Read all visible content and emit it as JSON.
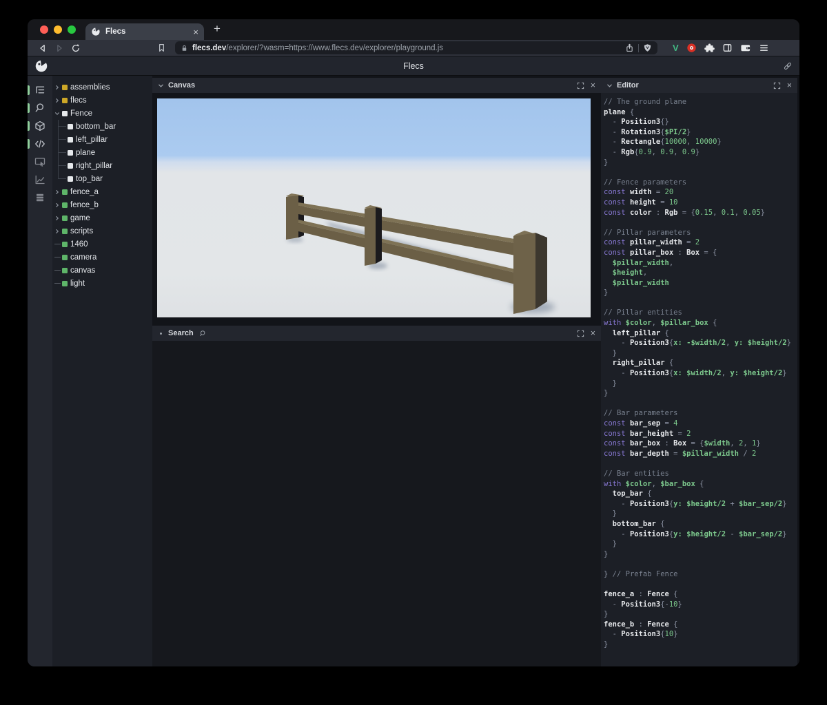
{
  "browser": {
    "traffic_lights": {
      "close": "#ff5f57",
      "minimize": "#febc2e",
      "zoom": "#28c840"
    },
    "tab": {
      "title": "Flecs",
      "close_glyph": "×",
      "new_tab_glyph": "+"
    },
    "url": {
      "domain": "flecs.dev",
      "path": "/explorer/?wasm=https://www.flecs.dev/explorer/playground.js"
    },
    "extensions": {
      "vue_label": "V"
    }
  },
  "app": {
    "header_title": "Flecs",
    "panels": {
      "canvas": "Canvas",
      "search": "Search",
      "editor": "Editor"
    }
  },
  "sidebar_icons": [
    {
      "name": "entity-tree",
      "active": true
    },
    {
      "name": "search",
      "active": true
    },
    {
      "name": "cube-3d",
      "active": true
    },
    {
      "name": "code",
      "active": true
    },
    {
      "name": "screen-inspect",
      "active": false
    },
    {
      "name": "stats-chart",
      "active": false
    },
    {
      "name": "layers",
      "active": false
    }
  ],
  "tree": {
    "items": [
      {
        "label": "assemblies",
        "kind": "module",
        "marker": "collapsed"
      },
      {
        "label": "flecs",
        "kind": "module",
        "marker": "collapsed"
      },
      {
        "label": "Fence",
        "kind": "prefab",
        "marker": "expanded"
      },
      {
        "label": "bottom_bar",
        "kind": "prefab",
        "marker": "child"
      },
      {
        "label": "left_pillar",
        "kind": "prefab",
        "marker": "child"
      },
      {
        "label": "plane",
        "kind": "prefab",
        "marker": "child"
      },
      {
        "label": "right_pillar",
        "kind": "prefab",
        "marker": "child"
      },
      {
        "label": "top_bar",
        "kind": "prefab",
        "marker": "child"
      },
      {
        "label": "fence_a",
        "kind": "entity",
        "marker": "collapsed"
      },
      {
        "label": "fence_b",
        "kind": "entity",
        "marker": "collapsed"
      },
      {
        "label": "game",
        "kind": "entity",
        "marker": "collapsed"
      },
      {
        "label": "scripts",
        "kind": "entity",
        "marker": "collapsed"
      },
      {
        "label": "1460",
        "kind": "entity",
        "marker": "leaf"
      },
      {
        "label": "camera",
        "kind": "entity",
        "marker": "leaf"
      },
      {
        "label": "canvas",
        "kind": "entity",
        "marker": "leaf"
      },
      {
        "label": "light",
        "kind": "entity",
        "marker": "leaf"
      }
    ],
    "dot_colors": {
      "module": "#cda727",
      "prefab": "#e6e9ec",
      "entity": "#5eb569"
    }
  },
  "editor_code": {
    "lines": [
      [
        [
          "// The ground plane",
          "c"
        ]
      ],
      [
        [
          "plane",
          "i"
        ],
        [
          " {",
          "p"
        ]
      ],
      [
        [
          "  - ",
          "p"
        ],
        [
          "Position3",
          "i"
        ],
        [
          "{}",
          "p"
        ]
      ],
      [
        [
          "  - ",
          "p"
        ],
        [
          "Rotation3",
          "i"
        ],
        [
          "{",
          "p"
        ],
        [
          "$PI/2",
          "v"
        ],
        [
          "}",
          "p"
        ]
      ],
      [
        [
          "  - ",
          "p"
        ],
        [
          "Rectangle",
          "i"
        ],
        [
          "{",
          "p"
        ],
        [
          "10000",
          "n"
        ],
        [
          ", ",
          "p"
        ],
        [
          "10000",
          "n"
        ],
        [
          "}",
          "p"
        ]
      ],
      [
        [
          "  - ",
          "p"
        ],
        [
          "Rgb",
          "i"
        ],
        [
          "{",
          "p"
        ],
        [
          "0.9",
          "n"
        ],
        [
          ", ",
          "p"
        ],
        [
          "0.9",
          "n"
        ],
        [
          ", ",
          "p"
        ],
        [
          "0.9",
          "n"
        ],
        [
          "}",
          "p"
        ]
      ],
      [
        [
          "}",
          "p"
        ]
      ],
      [],
      [
        [
          "// Fence parameters",
          "c"
        ]
      ],
      [
        [
          "const",
          "k"
        ],
        [
          " ",
          "p"
        ],
        [
          "width",
          "i"
        ],
        [
          " = ",
          "p"
        ],
        [
          "20",
          "n"
        ]
      ],
      [
        [
          "const",
          "k"
        ],
        [
          " ",
          "p"
        ],
        [
          "height",
          "i"
        ],
        [
          " = ",
          "p"
        ],
        [
          "10",
          "n"
        ]
      ],
      [
        [
          "const",
          "k"
        ],
        [
          " ",
          "p"
        ],
        [
          "color",
          "i"
        ],
        [
          " : ",
          "p"
        ],
        [
          "Rgb",
          "i"
        ],
        [
          " = {",
          "p"
        ],
        [
          "0.15",
          "n"
        ],
        [
          ", ",
          "p"
        ],
        [
          "0.1",
          "n"
        ],
        [
          ", ",
          "p"
        ],
        [
          "0.05",
          "n"
        ],
        [
          "}",
          "p"
        ]
      ],
      [],
      [
        [
          "// Pillar parameters",
          "c"
        ]
      ],
      [
        [
          "const",
          "k"
        ],
        [
          " ",
          "p"
        ],
        [
          "pillar_width",
          "i"
        ],
        [
          " = ",
          "p"
        ],
        [
          "2",
          "n"
        ]
      ],
      [
        [
          "const",
          "k"
        ],
        [
          " ",
          "p"
        ],
        [
          "pillar_box",
          "i"
        ],
        [
          " : ",
          "p"
        ],
        [
          "Box",
          "i"
        ],
        [
          " = {",
          "p"
        ]
      ],
      [
        [
          "  ",
          "p"
        ],
        [
          "$pillar_width",
          "v"
        ],
        [
          ",",
          "p"
        ]
      ],
      [
        [
          "  ",
          "p"
        ],
        [
          "$height",
          "v"
        ],
        [
          ",",
          "p"
        ]
      ],
      [
        [
          "  ",
          "p"
        ],
        [
          "$pillar_width",
          "v"
        ]
      ],
      [
        [
          "}",
          "p"
        ]
      ],
      [],
      [
        [
          "// Pillar entities",
          "c"
        ]
      ],
      [
        [
          "with",
          "k"
        ],
        [
          " ",
          "p"
        ],
        [
          "$color",
          "v"
        ],
        [
          ", ",
          "p"
        ],
        [
          "$pillar_box",
          "v"
        ],
        [
          " {",
          "p"
        ]
      ],
      [
        [
          "  ",
          "p"
        ],
        [
          "left_pillar",
          "i"
        ],
        [
          " {",
          "p"
        ]
      ],
      [
        [
          "    - ",
          "p"
        ],
        [
          "Position3",
          "i"
        ],
        [
          "{",
          "p"
        ],
        [
          "x:",
          "v"
        ],
        [
          " ",
          "p"
        ],
        [
          "-$width/2",
          "v"
        ],
        [
          ", ",
          "p"
        ],
        [
          "y:",
          "v"
        ],
        [
          " ",
          "p"
        ],
        [
          "$height/2",
          "v"
        ],
        [
          "}",
          "p"
        ]
      ],
      [
        [
          "  }",
          "p"
        ]
      ],
      [
        [
          "  ",
          "p"
        ],
        [
          "right_pillar",
          "i"
        ],
        [
          " {",
          "p"
        ]
      ],
      [
        [
          "    - ",
          "p"
        ],
        [
          "Position3",
          "i"
        ],
        [
          "{",
          "p"
        ],
        [
          "x:",
          "v"
        ],
        [
          " ",
          "p"
        ],
        [
          "$width/2",
          "v"
        ],
        [
          ", ",
          "p"
        ],
        [
          "y:",
          "v"
        ],
        [
          " ",
          "p"
        ],
        [
          "$height/2",
          "v"
        ],
        [
          "}",
          "p"
        ]
      ],
      [
        [
          "  }",
          "p"
        ]
      ],
      [
        [
          "}",
          "p"
        ]
      ],
      [],
      [
        [
          "// Bar parameters",
          "c"
        ]
      ],
      [
        [
          "const",
          "k"
        ],
        [
          " ",
          "p"
        ],
        [
          "bar_sep",
          "i"
        ],
        [
          " = ",
          "p"
        ],
        [
          "4",
          "n"
        ]
      ],
      [
        [
          "const",
          "k"
        ],
        [
          " ",
          "p"
        ],
        [
          "bar_height",
          "i"
        ],
        [
          " = ",
          "p"
        ],
        [
          "2",
          "n"
        ]
      ],
      [
        [
          "const",
          "k"
        ],
        [
          " ",
          "p"
        ],
        [
          "bar_box",
          "i"
        ],
        [
          " : ",
          "p"
        ],
        [
          "Box",
          "i"
        ],
        [
          " = {",
          "p"
        ],
        [
          "$width",
          "v"
        ],
        [
          ", ",
          "p"
        ],
        [
          "2",
          "n"
        ],
        [
          ", ",
          "p"
        ],
        [
          "1",
          "n"
        ],
        [
          "}",
          "p"
        ]
      ],
      [
        [
          "const",
          "k"
        ],
        [
          " ",
          "p"
        ],
        [
          "bar_depth",
          "i"
        ],
        [
          " = ",
          "p"
        ],
        [
          "$pillar_width",
          "v"
        ],
        [
          " / ",
          "p"
        ],
        [
          "2",
          "n"
        ]
      ],
      [],
      [
        [
          "// Bar entities",
          "c"
        ]
      ],
      [
        [
          "with",
          "k"
        ],
        [
          " ",
          "p"
        ],
        [
          "$color",
          "v"
        ],
        [
          ", ",
          "p"
        ],
        [
          "$bar_box",
          "v"
        ],
        [
          " {",
          "p"
        ]
      ],
      [
        [
          "  ",
          "p"
        ],
        [
          "top_bar",
          "i"
        ],
        [
          " {",
          "p"
        ]
      ],
      [
        [
          "    - ",
          "p"
        ],
        [
          "Position3",
          "i"
        ],
        [
          "{",
          "p"
        ],
        [
          "y:",
          "v"
        ],
        [
          " ",
          "p"
        ],
        [
          "$height/2",
          "v"
        ],
        [
          " + ",
          "p"
        ],
        [
          "$bar_sep/2",
          "v"
        ],
        [
          "}",
          "p"
        ]
      ],
      [
        [
          "  }",
          "p"
        ]
      ],
      [
        [
          "  ",
          "p"
        ],
        [
          "bottom_bar",
          "i"
        ],
        [
          " {",
          "p"
        ]
      ],
      [
        [
          "    - ",
          "p"
        ],
        [
          "Position3",
          "i"
        ],
        [
          "{",
          "p"
        ],
        [
          "y:",
          "v"
        ],
        [
          " ",
          "p"
        ],
        [
          "$height/2",
          "v"
        ],
        [
          " - ",
          "p"
        ],
        [
          "$bar_sep/2",
          "v"
        ],
        [
          "}",
          "p"
        ]
      ],
      [
        [
          "  }",
          "p"
        ]
      ],
      [
        [
          "}",
          "p"
        ]
      ],
      [],
      [
        [
          "} ",
          "p"
        ],
        [
          "// Prefab Fence",
          "c"
        ]
      ],
      [],
      [
        [
          "fence_a",
          "i"
        ],
        [
          " : ",
          "p"
        ],
        [
          "Fence",
          "i"
        ],
        [
          " {",
          "p"
        ]
      ],
      [
        [
          "  - ",
          "p"
        ],
        [
          "Position3",
          "i"
        ],
        [
          "{",
          "p"
        ],
        [
          "-",
          "p"
        ],
        [
          "10",
          "n"
        ],
        [
          "}",
          "p"
        ]
      ],
      [
        [
          "}",
          "p"
        ]
      ],
      [
        [
          "fence_b",
          "i"
        ],
        [
          " : ",
          "p"
        ],
        [
          "Fence",
          "i"
        ],
        [
          " {",
          "p"
        ]
      ],
      [
        [
          "  - ",
          "p"
        ],
        [
          "Position3",
          "i"
        ],
        [
          "{",
          "p"
        ],
        [
          "10",
          "n"
        ],
        [
          "}",
          "p"
        ]
      ],
      [
        [
          "}",
          "p"
        ]
      ]
    ]
  },
  "scene": {
    "sky_color": "#a5c7ee",
    "ground_color": "#e3e6e8",
    "wood_front": "#6b5f46",
    "wood_top": "#7e7255",
    "wood_dark_side": "#1b1a1d",
    "shadow_color": "#5a6a82"
  },
  "colors": {
    "active_pill_green": "#8fcf9b",
    "code_keyword": "#8878d4",
    "code_variable": "#7dc98d",
    "code_comment": "#79818f",
    "vue_green": "#42b883"
  }
}
